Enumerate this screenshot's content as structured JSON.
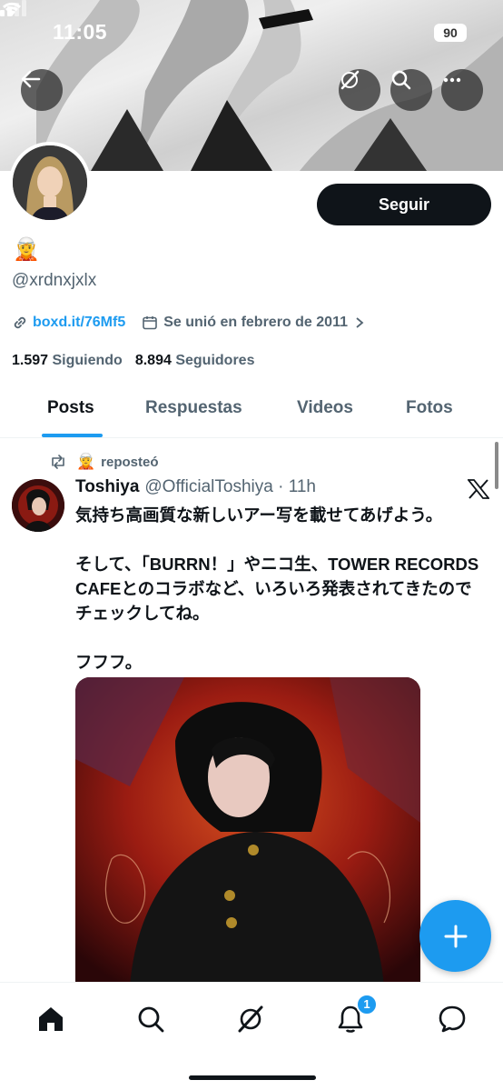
{
  "status_bar": {
    "time": "11:05",
    "battery": "90"
  },
  "header": {
    "back_icon": "arrow-left-icon",
    "actions": [
      "grok-icon",
      "search-icon",
      "more-icon"
    ]
  },
  "profile": {
    "display_name_emoji": "🧝",
    "handle": "@xrdnxjxlx",
    "follow_label": "Seguir",
    "link": "boxd.it/76Mf5",
    "joined": "Se unió en febrero de 2011",
    "following_count": "1.597",
    "following_label": "Siguiendo",
    "followers_count": "8.894",
    "followers_label": "Seguidores"
  },
  "tabs": [
    {
      "label": "Posts",
      "active": true
    },
    {
      "label": "Respuestas",
      "active": false
    },
    {
      "label": "Videos",
      "active": false
    },
    {
      "label": "Fotos",
      "active": false
    }
  ],
  "post": {
    "repost_emoji": "🧝",
    "repost_label": "reposteó",
    "author_name": "Toshiya",
    "author_handle_time": "@OfficialToshiya · 11h",
    "text": "気持ち高画質な新しいアー写を載せてあげよう。\n\nそして、「BURRN！」やニコ生、TOWER RECORDS CAFEとのコラボなど、いろいろ発表されてきたのでチェックしてね。\n\nフフフ。"
  },
  "bottom_nav": {
    "items": [
      "home-icon",
      "search-icon",
      "grok-icon",
      "notifications-icon",
      "messages-icon"
    ],
    "notification_badge": "1"
  },
  "colors": {
    "accent": "#1d9bf0",
    "text": "#0f1419",
    "secondary": "#536471"
  }
}
